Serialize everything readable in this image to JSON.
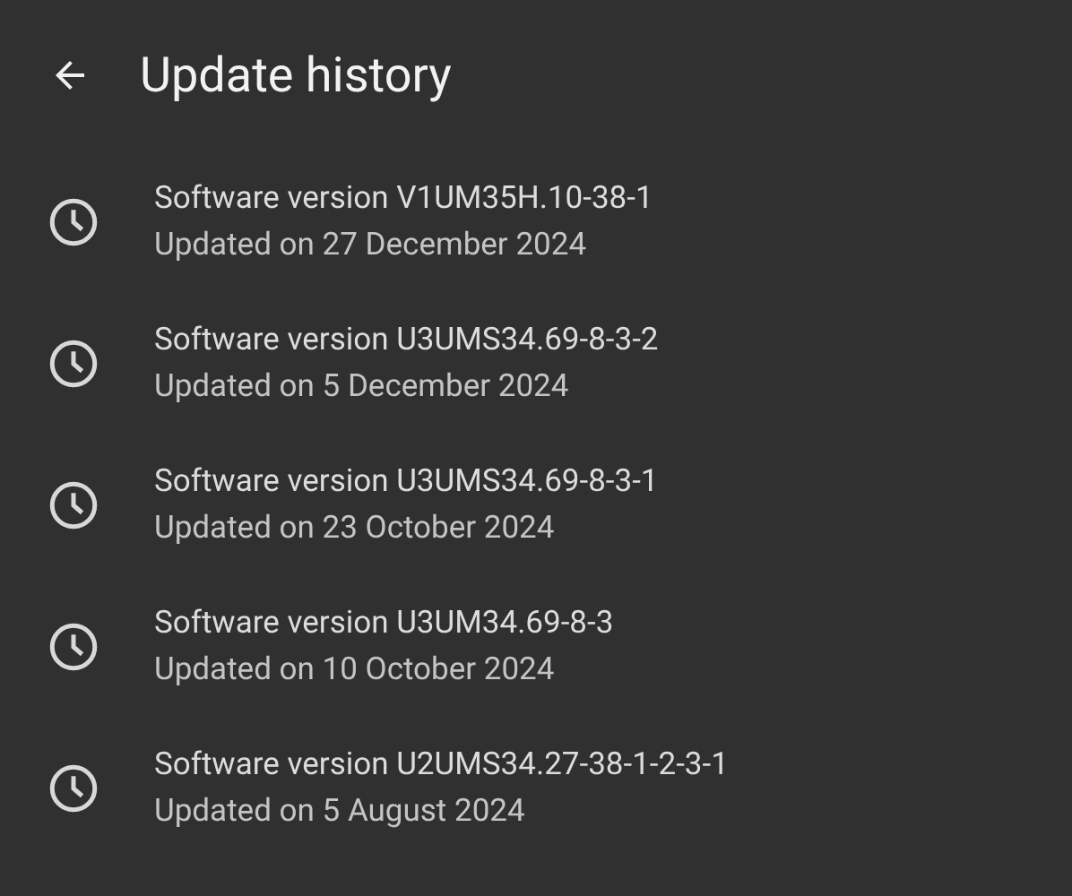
{
  "header": {
    "title": "Update history"
  },
  "updates": [
    {
      "version": "Software version V1UM35H.10-38-1",
      "date": "Updated on 27 December 2024"
    },
    {
      "version": "Software version U3UMS34.69-8-3-2",
      "date": "Updated on 5 December 2024"
    },
    {
      "version": "Software version U3UMS34.69-8-3-1",
      "date": "Updated on 23 October 2024"
    },
    {
      "version": "Software version U3UM34.69-8-3",
      "date": "Updated on 10 October 2024"
    },
    {
      "version": "Software version U2UMS34.27-38-1-2-3-1",
      "date": "Updated on 5 August 2024"
    }
  ]
}
